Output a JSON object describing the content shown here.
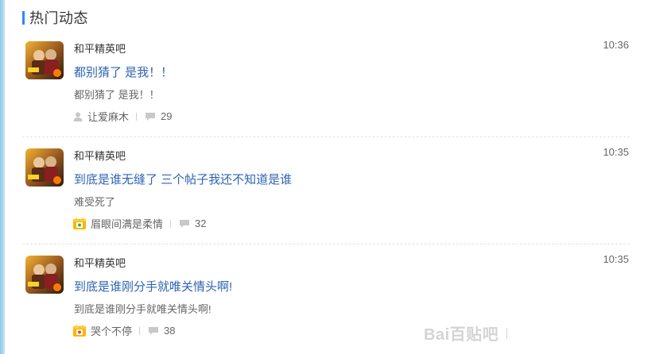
{
  "section": {
    "title": "热门动态"
  },
  "posts": [
    {
      "forum": "和平精英吧",
      "time": "10:36",
      "title": "都别猜了 是我！！",
      "excerpt": "都别猜了 是我！！",
      "author": "让爱麻木",
      "author_icon": "user-icon",
      "replies": "29"
    },
    {
      "forum": "和平精英吧",
      "time": "10:35",
      "title": "到底是谁无缝了 三个帖子我还不知道是谁",
      "excerpt": "难受死了",
      "author": "眉眼间满是柔情",
      "author_icon": "member-badge-icon",
      "replies": "32"
    },
    {
      "forum": "和平精英吧",
      "time": "10:35",
      "title": "到底是谁刚分手就唯关情头啊!",
      "excerpt": "到底是谁刚分手就唯关情头啊!",
      "author": "哭个不停",
      "author_icon": "member-badge-icon",
      "replies": "38"
    }
  ],
  "watermark": {
    "text": "Bai百贴吧"
  },
  "colors": {
    "accent": "#3385ff",
    "link": "#2d64b3",
    "sidebar": "#8fc6ea"
  }
}
